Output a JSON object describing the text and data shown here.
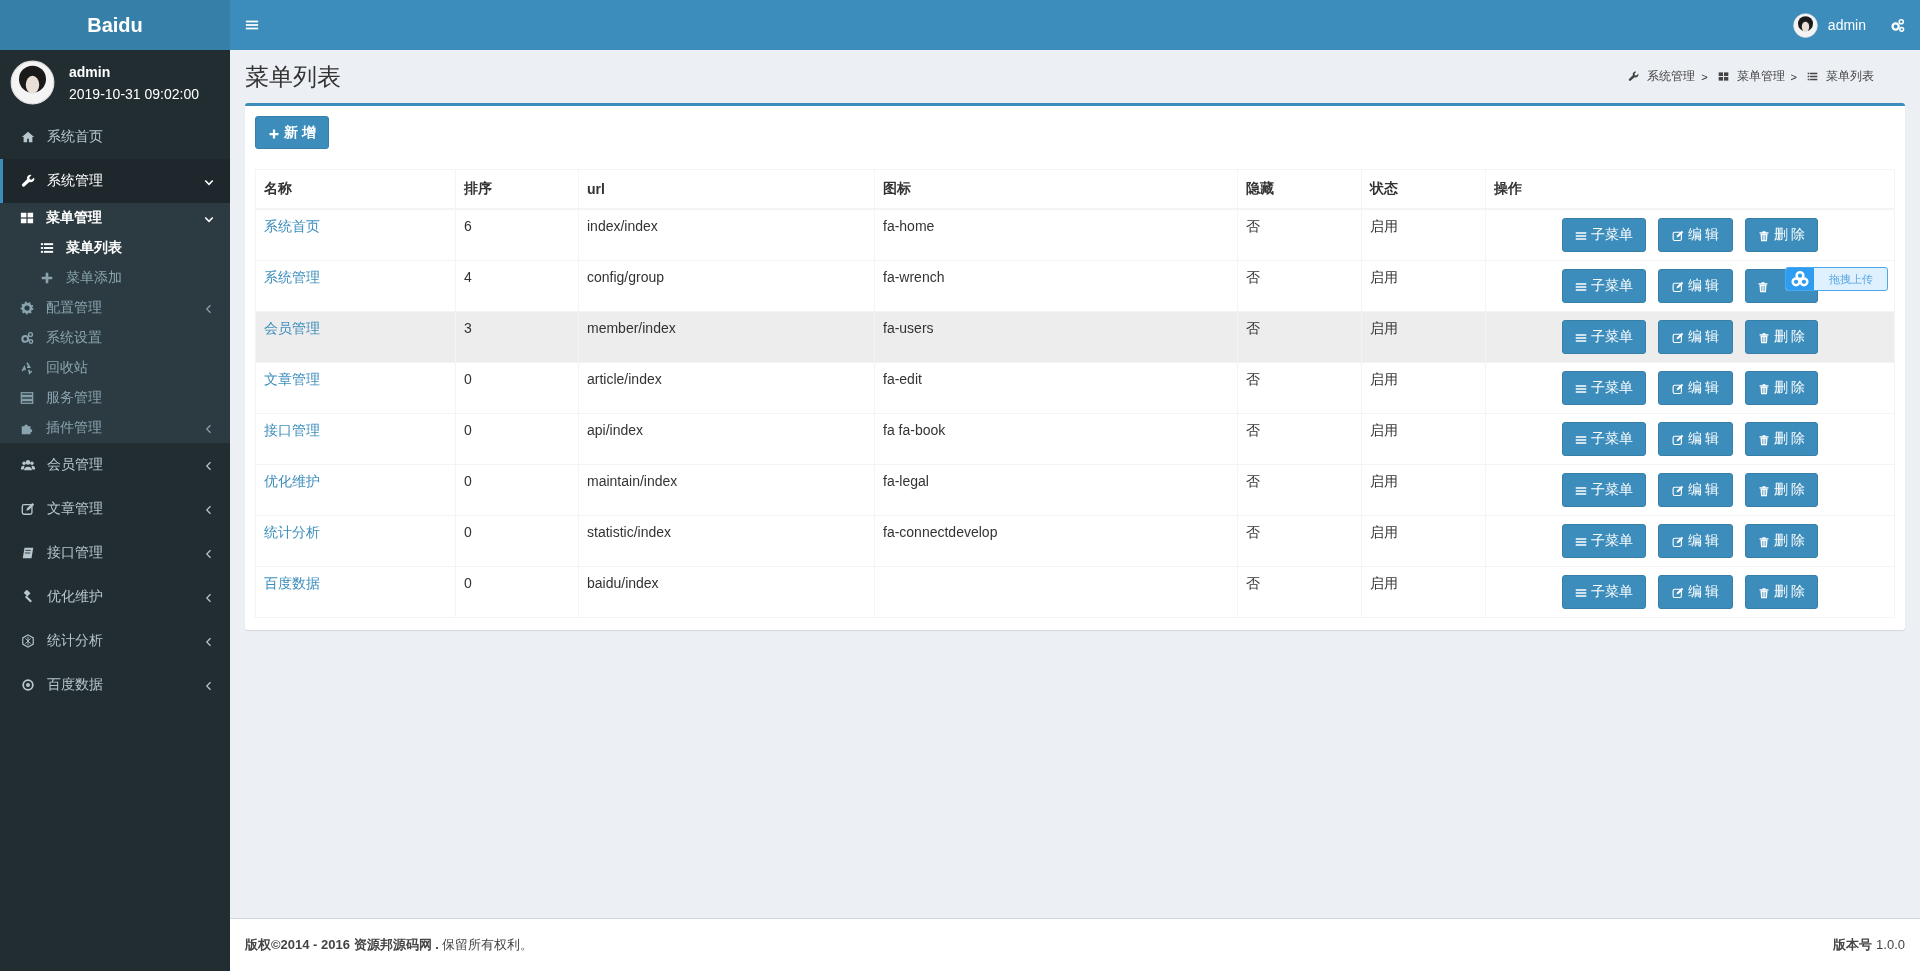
{
  "brand": "Baidu",
  "user_panel": {
    "name": "admin",
    "time": "2019-10-31 09:02:00"
  },
  "sidebar": {
    "items": [
      {
        "label": "系统首页",
        "selected": false
      },
      {
        "label": "系统管理",
        "selected": true,
        "expanded": true,
        "children": [
          {
            "label": "菜单管理",
            "selected": true,
            "expanded": true,
            "children": [
              {
                "label": "菜单列表",
                "selected": true
              },
              {
                "label": "菜单添加",
                "selected": false
              }
            ]
          },
          {
            "label": "配置管理",
            "selected": false,
            "expanded": false
          },
          {
            "label": "系统设置",
            "selected": false
          },
          {
            "label": "回收站",
            "selected": false
          },
          {
            "label": "服务管理",
            "selected": false
          },
          {
            "label": "插件管理",
            "selected": false,
            "expanded": false
          }
        ]
      },
      {
        "label": "会员管理",
        "selected": false,
        "expanded": false
      },
      {
        "label": "文章管理",
        "selected": false,
        "expanded": false
      },
      {
        "label": "接口管理",
        "selected": false,
        "expanded": false
      },
      {
        "label": "优化维护",
        "selected": false,
        "expanded": false
      },
      {
        "label": "统计分析",
        "selected": false,
        "expanded": false
      },
      {
        "label": "百度数据",
        "selected": false,
        "expanded": false
      }
    ]
  },
  "header": {
    "user": "admin"
  },
  "page_title": "菜单列表",
  "breadcrumb": [
    {
      "label": "系统管理",
      "separator": ">"
    },
    {
      "label": "菜单管理",
      "separator": ">"
    },
    {
      "label": "菜单列表"
    }
  ],
  "add_button": "新 增",
  "table": {
    "columns": [
      "名称",
      "排序",
      "url",
      "图标",
      "隐藏",
      "状态",
      "操作"
    ],
    "rows": [
      {
        "name": "系统首页",
        "sort": "6",
        "url": "index/index",
        "icon": "fa-home",
        "hidden": "否",
        "status": "启用",
        "highlighted": false,
        "actions": [
          "子菜单",
          "编 辑",
          "删 除"
        ]
      },
      {
        "name": "系统管理",
        "sort": "4",
        "url": "config/group",
        "icon": "fa-wrench",
        "hidden": "否",
        "status": "启用",
        "highlighted": false,
        "actions": [
          "子菜单",
          "编 辑"
        ]
      },
      {
        "name": "会员管理",
        "sort": "3",
        "url": "member/index",
        "icon": "fa-users",
        "hidden": "否",
        "status": "启用",
        "highlighted": true,
        "actions": [
          "子菜单",
          "编 辑",
          "删 除"
        ]
      },
      {
        "name": "文章管理",
        "sort": "0",
        "url": "article/index",
        "icon": "fa-edit",
        "hidden": "否",
        "status": "启用",
        "highlighted": false,
        "actions": [
          "子菜单",
          "编 辑",
          "删 除"
        ]
      },
      {
        "name": "接口管理",
        "sort": "0",
        "url": "api/index",
        "icon": "fa fa-book",
        "hidden": "否",
        "status": "启用",
        "highlighted": false,
        "actions": [
          "子菜单",
          "编 辑",
          "删 除"
        ]
      },
      {
        "name": "优化维护",
        "sort": "0",
        "url": "maintain/index",
        "icon": "fa-legal",
        "hidden": "否",
        "status": "启用",
        "highlighted": false,
        "actions": [
          "子菜单",
          "编 辑",
          "删 除"
        ]
      },
      {
        "name": "统计分析",
        "sort": "0",
        "url": "statistic/index",
        "icon": "fa-connectdevelop",
        "hidden": "否",
        "status": "启用",
        "highlighted": false,
        "actions": [
          "子菜单",
          "编 辑",
          "删 除"
        ]
      },
      {
        "name": "百度数据",
        "sort": "0",
        "url": "baidu/index",
        "hidden": "否",
        "status": "启用",
        "highlighted": false,
        "actions": [
          "子菜单",
          "编 辑",
          "删 除"
        ]
      }
    ]
  },
  "upload_widget": {
    "label": "拖拽上传"
  },
  "footer": {
    "copyright": "**版权©2014 - 2016 资源邦源码网 .** 保留所有权利。",
    "version": "**版本号** 1.0.0"
  }
}
